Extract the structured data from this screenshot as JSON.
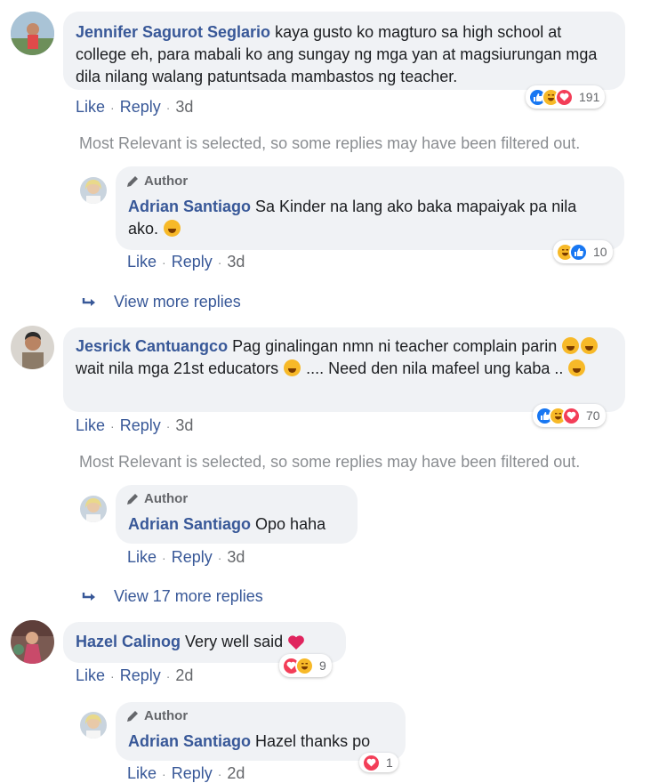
{
  "comments": [
    {
      "author_name": "Jennifer Sagurot Seglario",
      "text": "kaya gusto ko magturo sa high school at college eh, para mabali ko ang sungay ng mga yan at magsiurungan mga dila nilang walang patuntsada mambastos ng teacher.",
      "like_label": "Like",
      "reply_label": "Reply",
      "time": "3d",
      "reaction_count": "191",
      "reactions": [
        "like-icon",
        "haha-icon",
        "love-icon"
      ]
    },
    {
      "author_name": "Jesrick Cantuangco",
      "text_1": "Pag ginalingan nmn ni teacher complain parin",
      "text_2": "wait nila mga 21st educators",
      "text_3": ".... Need den nila mafeel ung kaba ..",
      "like_label": "Like",
      "reply_label": "Reply",
      "time": "3d",
      "reaction_count": "70",
      "reactions": [
        "like-icon",
        "haha-icon",
        "love-icon"
      ]
    },
    {
      "author_name": "Hazel Calinog",
      "text": "Very well said",
      "like_label": "Like",
      "reply_label": "Reply",
      "time": "2d",
      "reaction_count": "9",
      "reactions": [
        "love-icon",
        "haha-icon"
      ]
    }
  ],
  "replies": [
    {
      "badge": "Author",
      "author_name": "Adrian Santiago",
      "text": "Sa Kinder na lang ako baka mapaiyak pa nila ako.",
      "like_label": "Like",
      "reply_label": "Reply",
      "time": "3d",
      "reaction_count": "10",
      "reactions": [
        "haha-icon",
        "like-icon"
      ]
    },
    {
      "badge": "Author",
      "author_name": "Adrian Santiago",
      "text": "Opo haha",
      "like_label": "Like",
      "reply_label": "Reply",
      "time": "3d"
    },
    {
      "badge": "Author",
      "author_name": "Adrian Santiago",
      "text": "Hazel thanks po",
      "like_label": "Like",
      "reply_label": "Reply",
      "time": "2d",
      "reaction_count": "1",
      "reactions": [
        "love-icon"
      ]
    }
  ],
  "filter_notice": "Most Relevant is selected, so some replies may have been filtered out.",
  "view_more_1": "View more replies",
  "view_more_2": "View 17 more replies",
  "colors": {
    "link": "#385898",
    "bubble": "#f0f2f5",
    "like": "#1877f2",
    "haha": "#f7b928",
    "love": "#f33e58"
  }
}
